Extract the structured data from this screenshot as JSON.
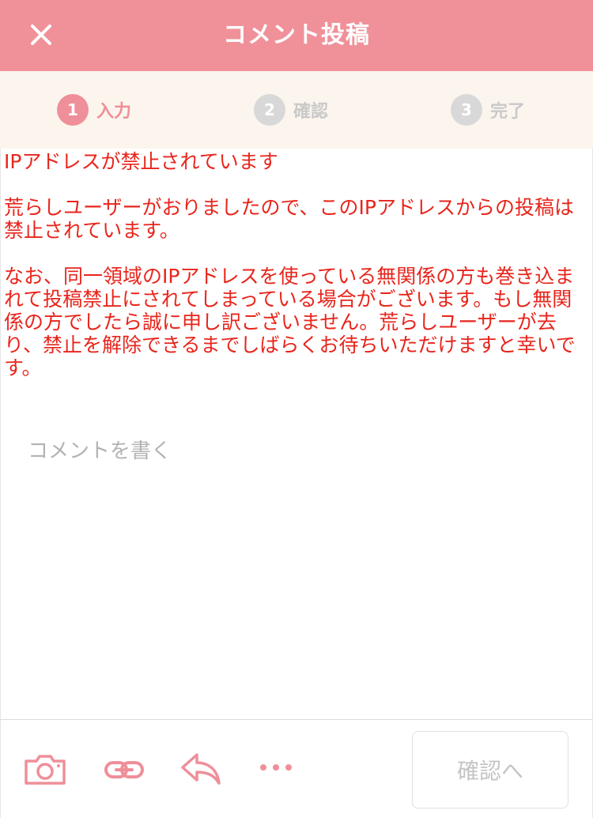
{
  "header": {
    "title": "コメント投稿",
    "close_icon": "close-icon"
  },
  "steps": [
    {
      "num": "1",
      "label": "入力",
      "state": "active"
    },
    {
      "num": "2",
      "label": "確認",
      "state": "inactive"
    },
    {
      "num": "3",
      "label": "完了",
      "state": "inactive"
    }
  ],
  "error": {
    "title": "IPアドレスが禁止されています",
    "reason": "荒らしユーザーがおりましたので、このIPアドレスからの投稿は禁止されています。",
    "notice": "なお、同一領域のIPアドレスを使っている無関係の方も巻き込まれて投稿禁止にされてしまっている場合がございます。もし無関係の方でしたら誠に申し訳ございません。荒らしユーザーが去り、禁止を解除できるまでしばらくお待ちいただけますと幸いです。"
  },
  "comment": {
    "placeholder": "コメントを書く",
    "value": ""
  },
  "toolbar": {
    "icons": [
      "camera-icon",
      "link-icon",
      "reply-icon",
      "more-icon"
    ],
    "confirm_label": "確認へ"
  },
  "colors": {
    "brand": "#f0919a",
    "step_bg": "#fbf5ee",
    "error": "#e8251c",
    "inactive": "#d8d8d8"
  }
}
